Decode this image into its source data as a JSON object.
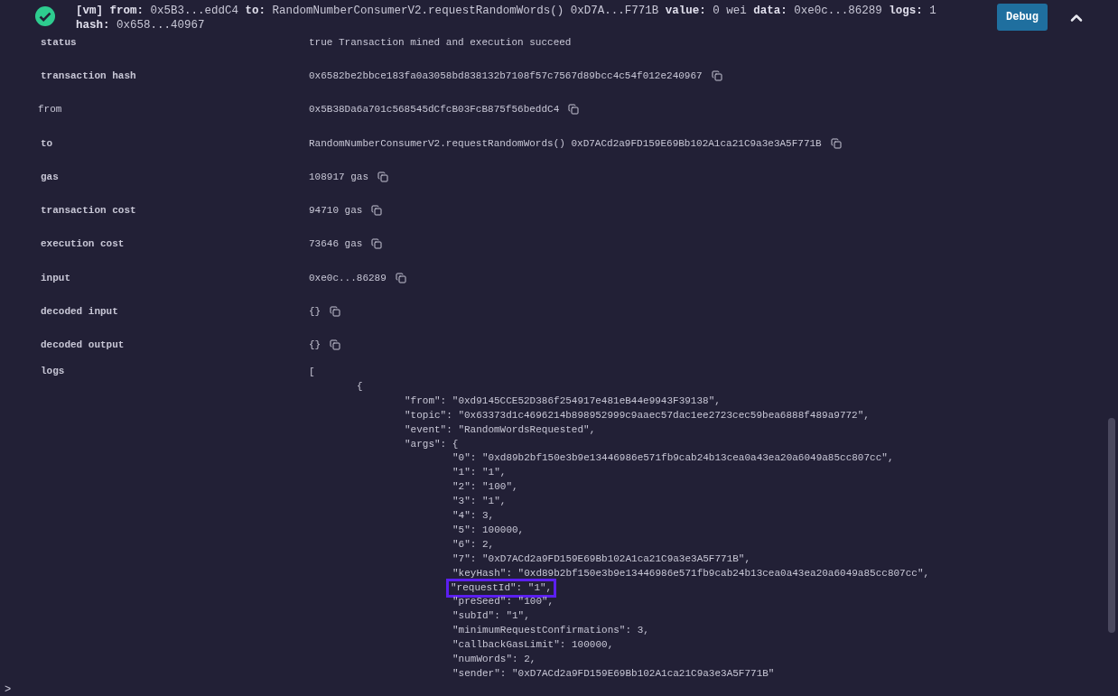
{
  "header": {
    "succeeded": true,
    "summary": "**[vm]** **from:** 0x5B3...eddC4 **to:** RandomNumberConsumerV2.requestRandomWords() 0xD7A...F771B **value:** 0 wei **data:** 0xe0c...86289 **logs:** 1 **hash:** 0x658...40967",
    "debug_button": "Debug",
    "expanded": true
  },
  "rows": [
    {
      "label": "status",
      "bold": true,
      "value": "true Transaction mined and execution succeed",
      "copy": false
    },
    {
      "label": "transaction hash",
      "bold": true,
      "value": "0x6582be2bbce183fa0a3058bd838132b7108f57c7567d89bcc4c54f012e240967",
      "copy": true
    },
    {
      "label": "from",
      "bold": false,
      "value": "0x5B38Da6a701c568545dCfcB03FcB875f56beddC4",
      "copy": true
    },
    {
      "label": "to",
      "bold": true,
      "value": "RandomNumberConsumerV2.requestRandomWords() 0xD7ACd2a9FD159E69Bb102A1ca21C9a3e3A5F771B",
      "copy": true
    },
    {
      "label": "gas",
      "bold": true,
      "value": "108917 gas",
      "copy": true
    },
    {
      "label": "transaction cost",
      "bold": true,
      "value": "94710 gas",
      "copy": true
    },
    {
      "label": "execution cost",
      "bold": true,
      "value": "73646 gas",
      "copy": true
    },
    {
      "label": "input",
      "bold": true,
      "value": "0xe0c...86289",
      "copy": true
    },
    {
      "label": "decoded input",
      "bold": true,
      "value": "{}",
      "copy": true
    },
    {
      "label": "decoded output",
      "bold": true,
      "value": "{}",
      "copy": true
    }
  ],
  "logs": {
    "label": "logs",
    "lines": [
      {
        "text": "[",
        "children": [
          {
            "text": "{",
            "children": [
              {
                "text": "\"from\": \"0xd9145CCE52D386f254917e481eB44e9943F39138\","
              },
              {
                "text": "\"topic\": \"0x63373d1c4696214b898952999c9aaec57dac1ee2723cec59bea6888f489a9772\","
              },
              {
                "text": "\"event\": \"RandomWordsRequested\","
              },
              {
                "text": "\"args\": {",
                "children": [
                  {
                    "text": "\"0\": \"0xd89b2bf150e3b9e13446986e571fb9cab24b13cea0a43ea20a6049a85cc807cc\",",
                    "highlighted": false
                  },
                  {
                    "text": "\"1\": \"1\",",
                    "highlighted": false
                  },
                  {
                    "text": "\"2\": \"100\",",
                    "highlighted": false
                  },
                  {
                    "text": "\"3\": \"1\",",
                    "highlighted": false
                  },
                  {
                    "text": "\"4\": 3,",
                    "highlighted": false
                  },
                  {
                    "text": "\"5\": 100000,",
                    "highlighted": false
                  },
                  {
                    "text": "\"6\": 2,",
                    "highlighted": false
                  },
                  {
                    "text": "\"7\": \"0xD7ACd2a9FD159E69Bb102A1ca21C9a3e3A5F771B\",",
                    "highlighted": false
                  },
                  {
                    "text": "\"keyHash\": \"0xd89b2bf150e3b9e13446986e571fb9cab24b13cea0a43ea20a6049a85cc807cc\",",
                    "highlighted": false
                  },
                  {
                    "text": "\"requestId\": \"1\",",
                    "highlighted": true
                  },
                  {
                    "text": "\"preSeed\": \"100\",",
                    "highlighted": false
                  },
                  {
                    "text": "\"subId\": \"1\",",
                    "highlighted": false
                  },
                  {
                    "text": "\"minimumRequestConfirmations\": 3,",
                    "highlighted": false
                  },
                  {
                    "text": "\"callbackGasLimit\": 100000,",
                    "highlighted": false
                  },
                  {
                    "text": "\"numWords\": 2,",
                    "highlighted": false
                  },
                  {
                    "text": "\"sender\": \"0xD7ACd2a9FD159E69Bb102A1ca21C9a3e3A5F771B\"",
                    "highlighted": false
                  }
                ]
              }
            ]
          }
        ]
      }
    ]
  },
  "prompt": ">"
}
